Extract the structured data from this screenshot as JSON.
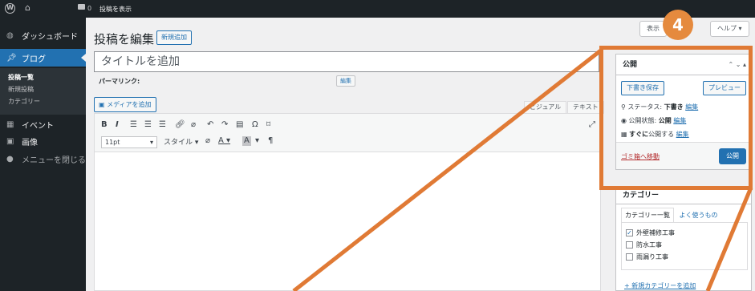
{
  "admin_bar": {
    "comment_count": "0",
    "view_post": "投稿を表示"
  },
  "sidebar": {
    "dashboard": "ダッシュボード",
    "posts": "ブログ",
    "sub": [
      "投稿一覧",
      "新規投稿",
      "カテゴリー"
    ],
    "events": "イベント",
    "media": "画像",
    "collapse": "メニューを閉じる"
  },
  "header": {
    "title": "投稿を編集",
    "new_button": "新規追加",
    "display_options": "表示",
    "help": "ヘルプ ▾"
  },
  "title_input": {
    "placeholder": "タイトルを追加"
  },
  "permalink": {
    "label": "パーマリンク:",
    "edit": "編集"
  },
  "editor": {
    "add_media": "メディアを追加",
    "tab_visual": "ビジュアル",
    "tab_text": "テキスト",
    "font_size": "11pt",
    "style": "スタイル"
  },
  "publish_panel": {
    "title": "公開",
    "save_draft": "下書き保存",
    "preview": "プレビュー",
    "status_label": "ステータス:",
    "status_value": "下書き",
    "visibility_label": "公開状態:",
    "visibility_value": "公開",
    "schedule_value": "すぐに",
    "schedule_suffix": "公開する",
    "edit": "編集",
    "trash": "ゴミ箱へ移動",
    "publish": "公開"
  },
  "category_panel": {
    "title": "カテゴリー",
    "tab_all": "カテゴリー一覧",
    "tab_popular": "よく使うもの",
    "items": [
      {
        "label": "外壁補修工事",
        "checked": true
      },
      {
        "label": "防水工事",
        "checked": false
      },
      {
        "label": "雨漏り工事",
        "checked": false
      }
    ],
    "add_new": "+ 新規カテゴリーを追加"
  },
  "annotation": {
    "number": "4",
    "color": "#e07a35"
  }
}
